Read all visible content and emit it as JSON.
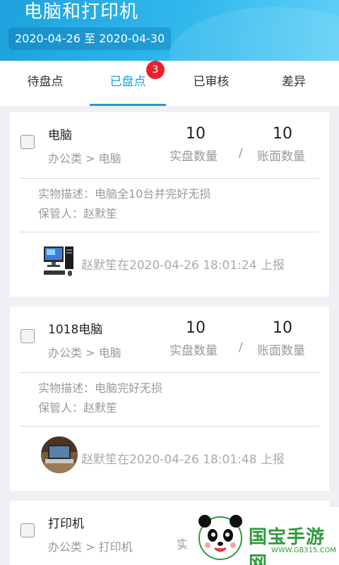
{
  "header": {
    "title": "电脑和打印机",
    "date_range": "2020-04-26 至 2020-04-30"
  },
  "tabs": [
    {
      "label": "待盘点"
    },
    {
      "label": "已盘点",
      "badge": "3",
      "active": true
    },
    {
      "label": "已审核"
    },
    {
      "label": "差异"
    }
  ],
  "labels": {
    "actual": "实盘数量",
    "sep": "/",
    "book": "账面数量"
  },
  "items": [
    {
      "name": "电脑",
      "category": "办公类 > 电脑",
      "actual_count": "10",
      "book_count": "10",
      "description": "实物描述：电脑全10台并完好无损",
      "custodian": "保管人：赵默笙",
      "report": "赵默笙在2020-04-26 18:01:24 上报",
      "thumb_icon": "desktop-computer-icon"
    },
    {
      "name": "1018电脑",
      "category": "办公类 > 电脑",
      "actual_count": "10",
      "book_count": "10",
      "description": "实物描述：电脑完好无损",
      "custodian": "保管人：赵默笙",
      "report": "赵默笙在2020-04-26 18:01:48 上报",
      "thumb_icon": "laptop-photo-icon"
    },
    {
      "name": "打印机",
      "category": "办公类 > 打印机",
      "actual_partial": "实"
    }
  ],
  "watermark": {
    "text": "国宝手游网",
    "url": "WWW.GB315.COM",
    "logo_icon": "panda-logo-icon"
  },
  "colors": {
    "accent": "#1a9fd6",
    "badge": "#e8222c",
    "header_start": "#1ea2dd",
    "header_end": "#5fd0f6"
  }
}
